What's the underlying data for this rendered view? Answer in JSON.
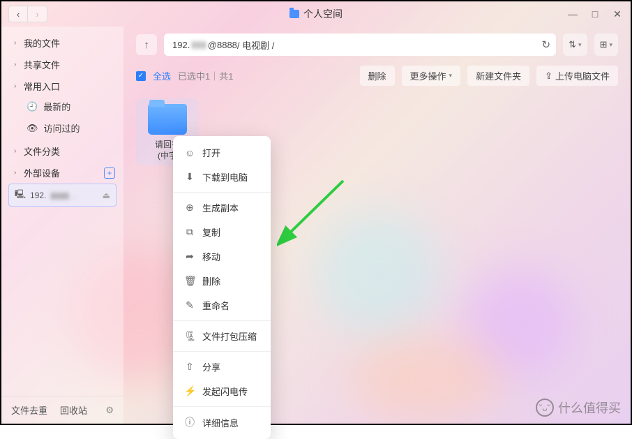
{
  "window": {
    "title": "个人空间",
    "nav_back": "‹",
    "nav_fwd": "›",
    "min": "—",
    "max": "□",
    "close": "✕"
  },
  "sidebar": {
    "groups": {
      "my_files": "我的文件",
      "shared": "共享文件",
      "common": "常用入口",
      "recent": "最新的",
      "visited": "访问过的",
      "categories": "文件分类",
      "external": "外部设备"
    },
    "device_prefix": "192.",
    "device_rest": "▮▮▮▮…",
    "footer": {
      "dedupe": "文件去重",
      "recycle": "回收站"
    }
  },
  "address": {
    "up": "↑",
    "host_prefix": "192.",
    "host_blur": "▮▮▮",
    "host_suffix": "@8888",
    "path": " / 电视剧 / ",
    "reload": "↻",
    "sort": "⇅",
    "view": "⊞"
  },
  "actions": {
    "select_all": "全选",
    "selection_info": "已选中1｜共1",
    "delete": "删除",
    "more": "更多操作",
    "new_folder": "新建文件夹",
    "upload": "上传电脑文件"
  },
  "file": {
    "line1": "请回答",
    "line2": "(中字"
  },
  "context_menu": {
    "open": "打开",
    "download": "下载到电脑",
    "duplicate": "生成副本",
    "copy": "复制",
    "move": "移动",
    "delete": "删除",
    "rename": "重命名",
    "compress": "文件打包压缩",
    "share": "分享",
    "flash": "发起闪电传",
    "details": "详细信息"
  },
  "watermark": "什么值得买"
}
